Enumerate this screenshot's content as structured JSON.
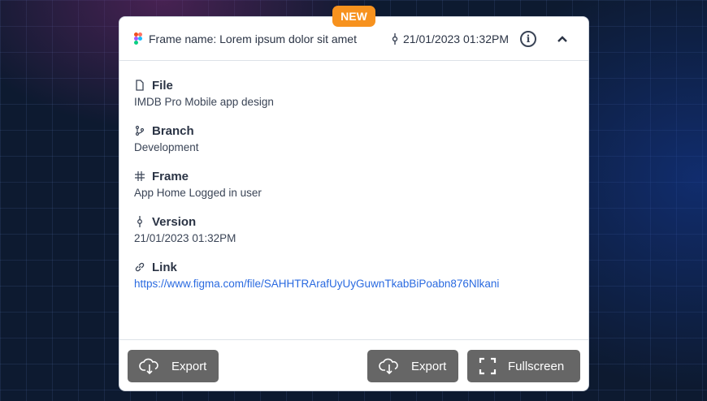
{
  "badge": "NEW",
  "header": {
    "frame_name": "Frame name: Lorem ipsum dolor sit amet",
    "version": "21/01/2023 01:32PM"
  },
  "details": [
    {
      "label": "File",
      "value": "IMDB Pro Mobile app design",
      "icon": "file-icon"
    },
    {
      "label": "Branch",
      "value": "Development",
      "icon": "branch-icon"
    },
    {
      "label": "Frame",
      "value": "App Home Logged in user",
      "icon": "hash-icon"
    },
    {
      "label": "Version",
      "value": "21/01/2023 01:32PM",
      "icon": "commit-icon"
    },
    {
      "label": "Link",
      "value": "https://www.figma.com/file/SAHHTRArafUyUyGuwnTkabBiPoabn876Nlkani",
      "icon": "link-icon"
    }
  ],
  "footer": {
    "export_left": "Export",
    "export_right": "Export",
    "fullscreen": "Fullscreen"
  },
  "colors": {
    "badge": "#f7921e",
    "button": "#666666",
    "link": "#2a6ae0"
  }
}
